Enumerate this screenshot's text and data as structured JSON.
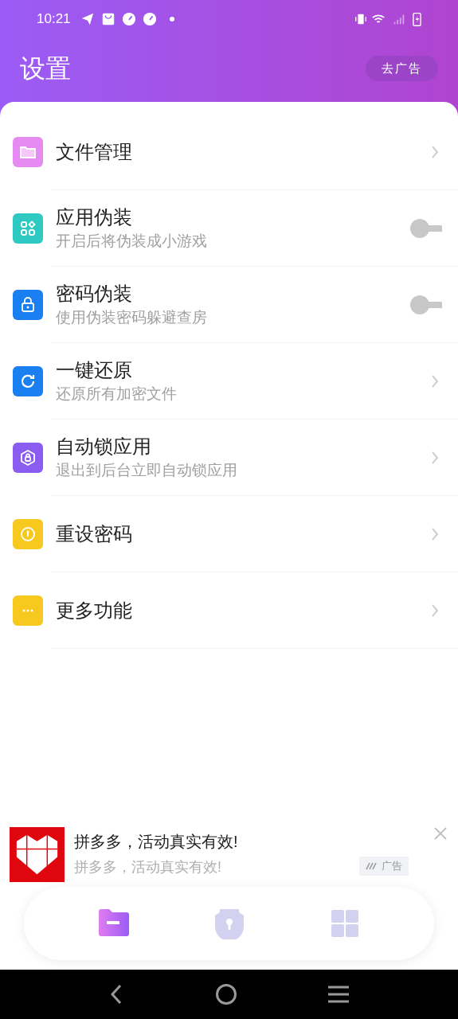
{
  "status_bar": {
    "time": "10:21"
  },
  "header": {
    "title": "设置",
    "button": "去广告"
  },
  "items": [
    {
      "kind": "link",
      "title": "文件管理",
      "color": "#e58af0"
    },
    {
      "kind": "toggle",
      "title": "应用伪装",
      "subtitle": "开启后将伪装成小游戏",
      "on": false,
      "color": "#2ec9c0"
    },
    {
      "kind": "toggle",
      "title": "密码伪装",
      "subtitle": "使用伪装密码躲避查房",
      "on": false,
      "color": "#1a7ff0"
    },
    {
      "kind": "link",
      "title": "一键还原",
      "subtitle": "还原所有加密文件",
      "color": "#1a7ff0"
    },
    {
      "kind": "link",
      "title": "自动锁应用",
      "subtitle": "退出到后台立即自动锁应用",
      "color": "#8a5cf0"
    },
    {
      "kind": "link",
      "title": "重设密码",
      "color": "#f7c81e"
    },
    {
      "kind": "link",
      "title": "更多功能",
      "color": "#f7c81e"
    }
  ],
  "ad": {
    "title": "拼多多，活动真实有效!",
    "subtitle": "拼多多，活动真实有效!",
    "badge": "广告"
  },
  "tabs": [
    {
      "selected": true
    },
    {
      "selected": false
    },
    {
      "selected": false
    }
  ]
}
